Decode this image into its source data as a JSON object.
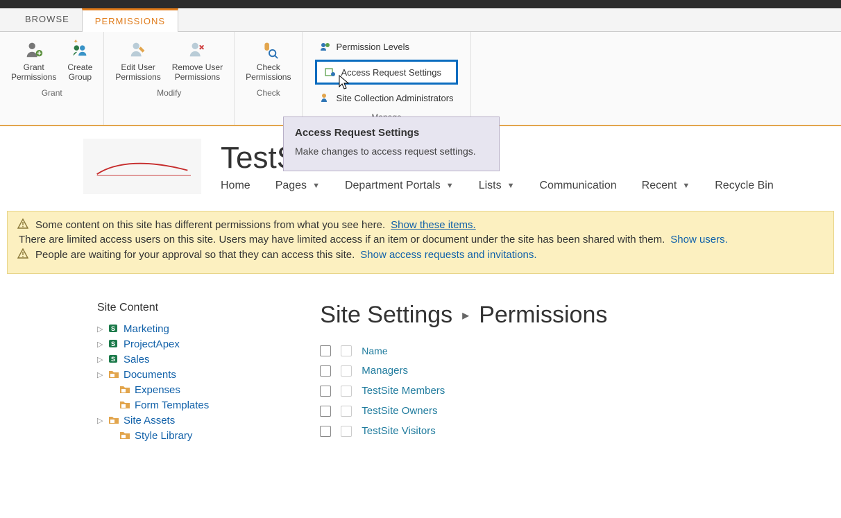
{
  "tabs": {
    "browse": "BROWSE",
    "permissions": "PERMISSIONS"
  },
  "ribbon": {
    "grant": {
      "grant_permissions": "Grant\nPermissions",
      "create_group": "Create\nGroup",
      "label": "Grant"
    },
    "modify": {
      "edit_user": "Edit User\nPermissions",
      "remove_user": "Remove User\nPermissions",
      "label": "Modify"
    },
    "check": {
      "check_permissions": "Check\nPermissions",
      "label": "Check"
    },
    "manage": {
      "permission_levels": "Permission Levels",
      "access_request_settings": "Access Request Settings",
      "site_collection_admins": "Site Collection Administrators",
      "label": "Manage"
    }
  },
  "tooltip": {
    "title": "Access Request Settings",
    "body": "Make changes to access request settings."
  },
  "site": {
    "title": "TestSite",
    "nav": {
      "home": "Home",
      "pages": "Pages",
      "department_portals": "Department Portals",
      "lists": "Lists",
      "communication": "Communication",
      "recent": "Recent",
      "recycle_bin": "Recycle Bin"
    }
  },
  "banner": {
    "line1_a": "Some content on this site has different permissions from what you see here.",
    "line1_link": "Show these items.",
    "line2_a": "There are limited access users on this site. Users may have limited access if an item or document under the site has been shared with them.",
    "line2_link": "Show users.",
    "line3_a": "People are waiting for your approval so that they can access this site.",
    "line3_link": "Show access requests and invitations."
  },
  "tree": {
    "header": "Site Content",
    "items": [
      {
        "label": "Marketing",
        "icon": "s",
        "expandable": true
      },
      {
        "label": "ProjectApex",
        "icon": "s",
        "expandable": true
      },
      {
        "label": "Sales",
        "icon": "s",
        "expandable": true
      },
      {
        "label": "Documents",
        "icon": "folder",
        "expandable": true
      },
      {
        "label": "Expenses",
        "icon": "folder",
        "expandable": false,
        "indent": 1
      },
      {
        "label": "Form Templates",
        "icon": "folder",
        "expandable": false,
        "indent": 1
      },
      {
        "label": "Site Assets",
        "icon": "folder",
        "expandable": true
      },
      {
        "label": "Style Library",
        "icon": "folder",
        "expandable": false,
        "indent": 1
      }
    ]
  },
  "breadcrumb": {
    "a": "Site Settings",
    "b": "Permissions"
  },
  "table": {
    "header": "Name",
    "rows": [
      {
        "name": "Managers"
      },
      {
        "name": "TestSite Members"
      },
      {
        "name": "TestSite Owners"
      },
      {
        "name": "TestSite Visitors"
      }
    ]
  }
}
